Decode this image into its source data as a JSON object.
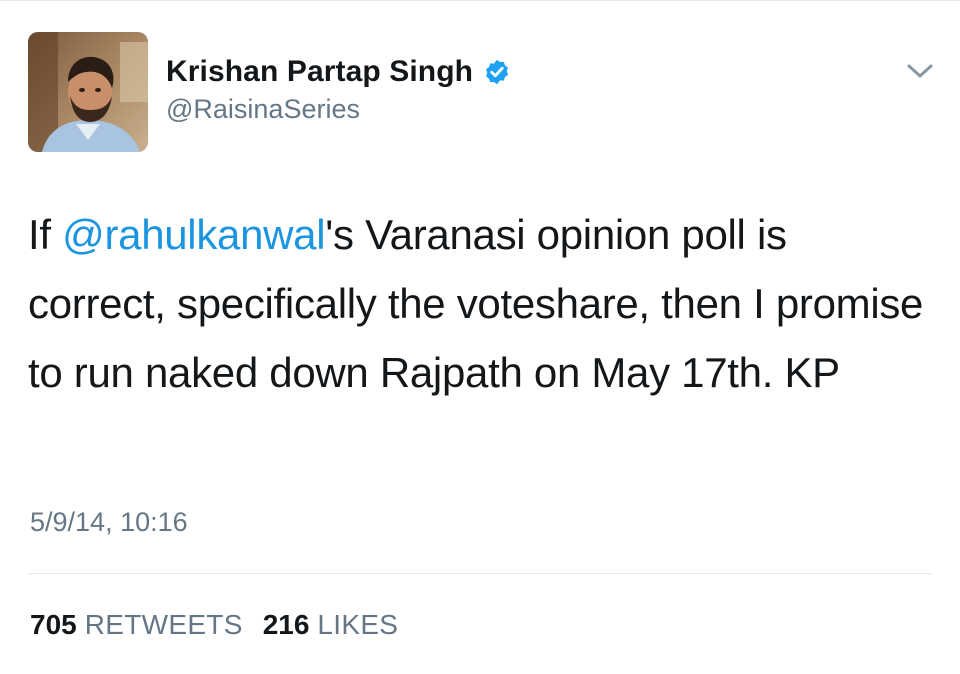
{
  "author": {
    "display_name": "Krishan Partap Singh",
    "handle": "@RaisinaSeries",
    "verified": true,
    "avatar_icon": "profile-photo"
  },
  "menu": {
    "caret_icon": "chevron-down-icon"
  },
  "tweet": {
    "text_prefix": "If ",
    "mention": "@rahulkanwal",
    "text_suffix": "'s Varanasi opinion poll is correct, specifically the voteshare, then I promise to run naked down Rajpath on May 17th. KP",
    "timestamp": "5/9/14, 10:16"
  },
  "stats": {
    "retweets_count": "705",
    "retweets_label": "RETWEETS",
    "likes_count": "216",
    "likes_label": "LIKES"
  },
  "colors": {
    "text": "#14171a",
    "secondary": "#657786",
    "link": "#1b95e0",
    "verified": "#1da1f2",
    "divider": "#e1e8ed"
  }
}
